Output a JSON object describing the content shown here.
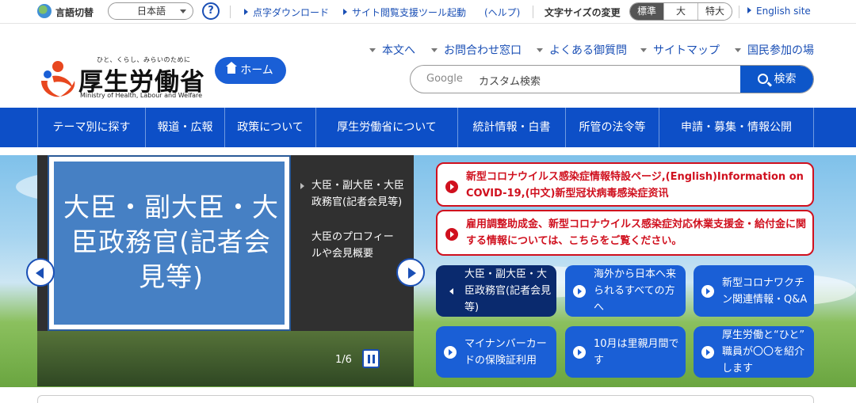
{
  "utility": {
    "language_label": "言語切替",
    "language_value": "日本語",
    "help_icon_text": "?",
    "links": [
      "点字ダウンロード",
      "サイト閲覧支援ツール起動",
      "(ヘルプ)"
    ],
    "font_size_label": "文字サイズの変更",
    "font_sizes": [
      "標準",
      "大",
      "特大"
    ],
    "english": "English site"
  },
  "header": {
    "tagline": "ひと、くらし、みらいのために",
    "logo_title": "厚生労働省",
    "logo_sub": "Ministry of Health, Labour and Welfare",
    "home": "ホーム",
    "links": [
      "本文へ",
      "お問合わせ窓口",
      "よくある御質問",
      "サイトマップ",
      "国民参加の場"
    ],
    "search": {
      "brand": "Google",
      "placeholder": "カスタム検索",
      "button": "検索"
    }
  },
  "nav": [
    "テーマ別に探す",
    "報道・広報",
    "政策について",
    "厚生労働省について",
    "統計情報・白書",
    "所管の法令等",
    "申請・募集・情報公開"
  ],
  "slider": {
    "panel_title": "大臣・副大臣・大臣政務官(記者会見等)",
    "side_title": "大臣・副大臣・大臣政務官(記者会見等)",
    "side_desc": "大臣のプロフィールや会見概要",
    "counter": "1/6"
  },
  "alerts": [
    "新型コロナウイルス感染症情報特設ページ,(English)Information on COVID-19,(中文)新型冠状病毒感染症资讯",
    "雇用調整助成金、新型コロナウイルス感染症対応休業支援金・給付金に関する情報については、こちらをご覧ください。"
  ],
  "tiles": [
    "大臣・副大臣・大臣政務官(記者会見等)",
    "海外から日本へ来られるすべての方へ",
    "新型コロナワクチン関連情報・Q&A",
    "マイナンバーカードの保険証利用",
    "10月は里親月間です",
    "厚生労働と“ひと” 職員が〇〇を紹介します"
  ],
  "colors": {
    "brand_blue": "#0d4fc7",
    "alert_red": "#d0101e",
    "tile_blue": "#1a5fd6",
    "tile_dark": "#0a2a6e"
  }
}
